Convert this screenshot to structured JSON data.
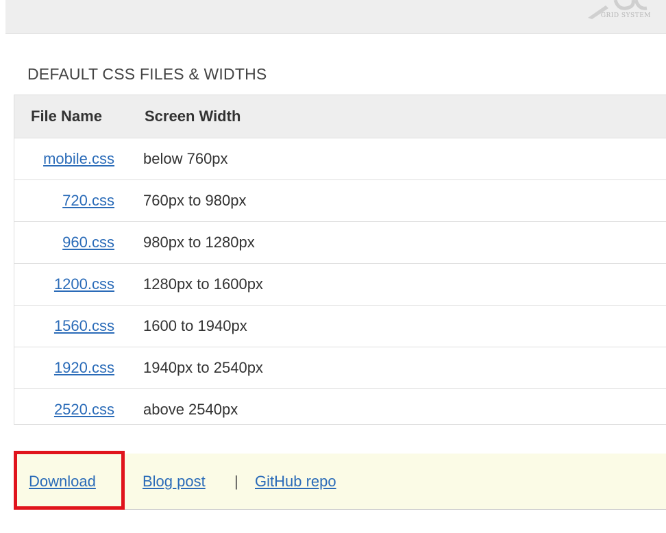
{
  "logo": {
    "text": "GRID SYSTEM",
    "colors": {
      "mark": "#c9c9c9",
      "text": "#b5b5b5"
    }
  },
  "section": {
    "title": "DEFAULT CSS FILES & WIDTHS"
  },
  "table": {
    "headers": {
      "file_name": "File Name",
      "screen_width": "Screen Width"
    },
    "rows": [
      {
        "file": "mobile.css",
        "width": "below 760px"
      },
      {
        "file": "720.css",
        "width": "760px to 980px"
      },
      {
        "file": "960.css",
        "width": "980px to 1280px"
      },
      {
        "file": "1200.css",
        "width": "1280px to 1600px"
      },
      {
        "file": "1560.css",
        "width": "1600 to 1940px"
      },
      {
        "file": "1920.css",
        "width": "1940px to 2540px"
      },
      {
        "file": "2520.css",
        "width": "above 2540px"
      }
    ]
  },
  "links": {
    "download": "Download",
    "blog_post": "Blog post",
    "separator": "|",
    "github_repo": "GitHub repo"
  },
  "colors": {
    "link": "#2a6bb8",
    "highlight_box": "#e0141c",
    "links_bar_bg": "#fbfbe6",
    "header_bg": "#eeeeee"
  }
}
